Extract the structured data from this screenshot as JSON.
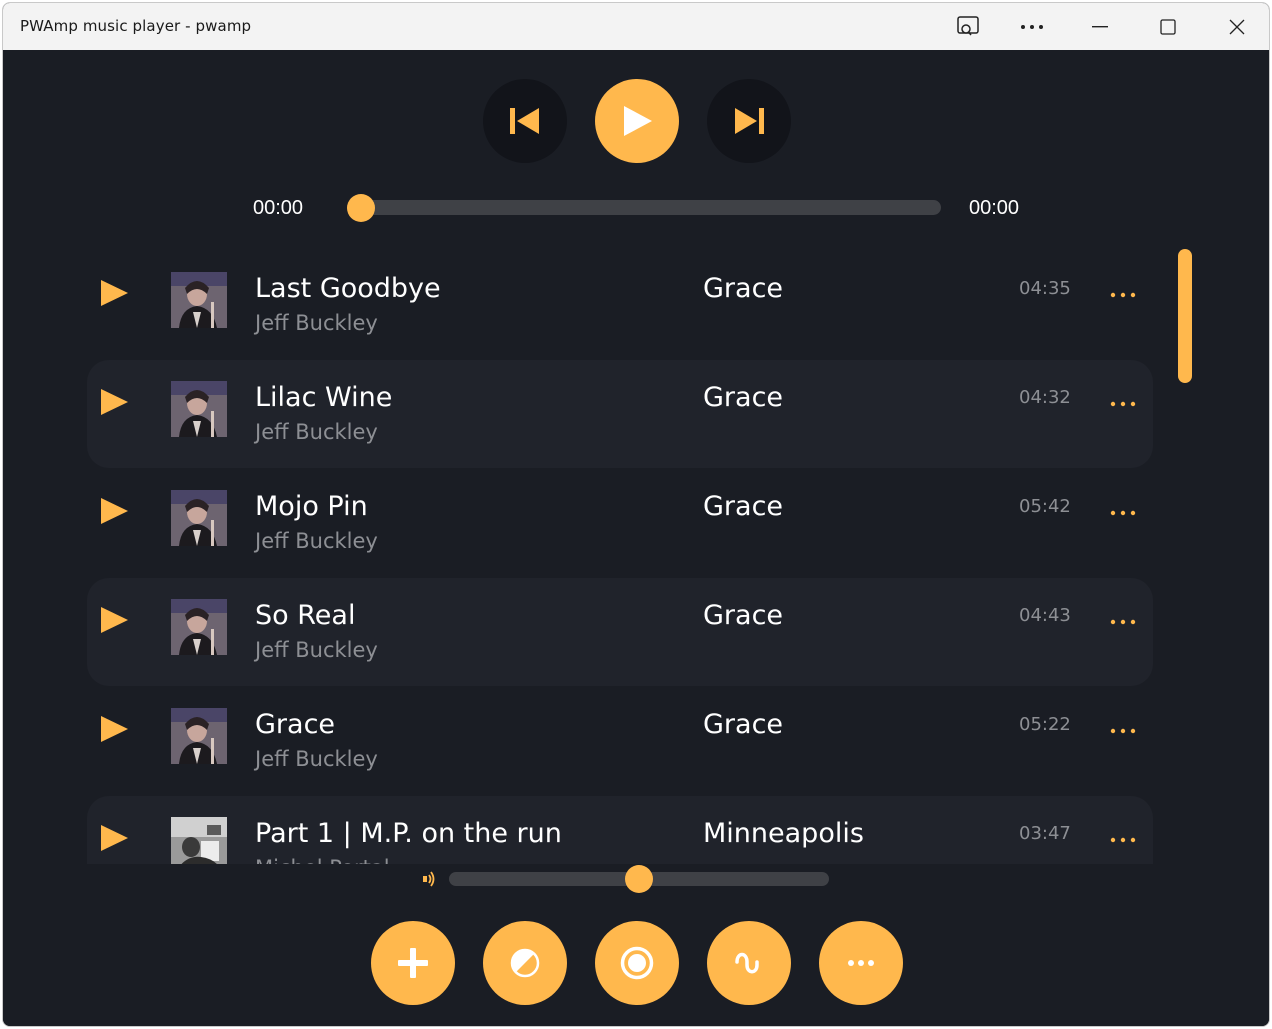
{
  "window": {
    "title": "PWAmp music player - pwamp",
    "controls": [
      "cast-icon",
      "more-icon",
      "minimize-icon",
      "maximize-icon",
      "close-icon"
    ]
  },
  "colors": {
    "accent": "#ffb84d",
    "background": "#1a1d24",
    "row_alt": "#20232b",
    "muted_text": "#8d8f94"
  },
  "player": {
    "elapsed": "00:00",
    "total": "00:00",
    "progress": 0,
    "volume": 0.5
  },
  "tracks": [
    {
      "title": "Last Goodbye",
      "artist": "Jeff Buckley",
      "album": "Grace",
      "duration": "04:35",
      "art": "grace"
    },
    {
      "title": "Lilac Wine",
      "artist": "Jeff Buckley",
      "album": "Grace",
      "duration": "04:32",
      "art": "grace"
    },
    {
      "title": "Mojo Pin",
      "artist": "Jeff Buckley",
      "album": "Grace",
      "duration": "05:42",
      "art": "grace"
    },
    {
      "title": "So Real",
      "artist": "Jeff Buckley",
      "album": "Grace",
      "duration": "04:43",
      "art": "grace"
    },
    {
      "title": "Grace",
      "artist": "Jeff Buckley",
      "album": "Grace",
      "duration": "05:22",
      "art": "grace"
    },
    {
      "title": "Part 1 | M.P. on the run",
      "artist": "Michel Portal",
      "album": "Minneapolis",
      "duration": "03:47",
      "art": "minneapolis"
    }
  ],
  "bottom_actions": [
    "add-icon",
    "theme-icon",
    "record-icon",
    "visualizer-icon",
    "more-icon"
  ]
}
